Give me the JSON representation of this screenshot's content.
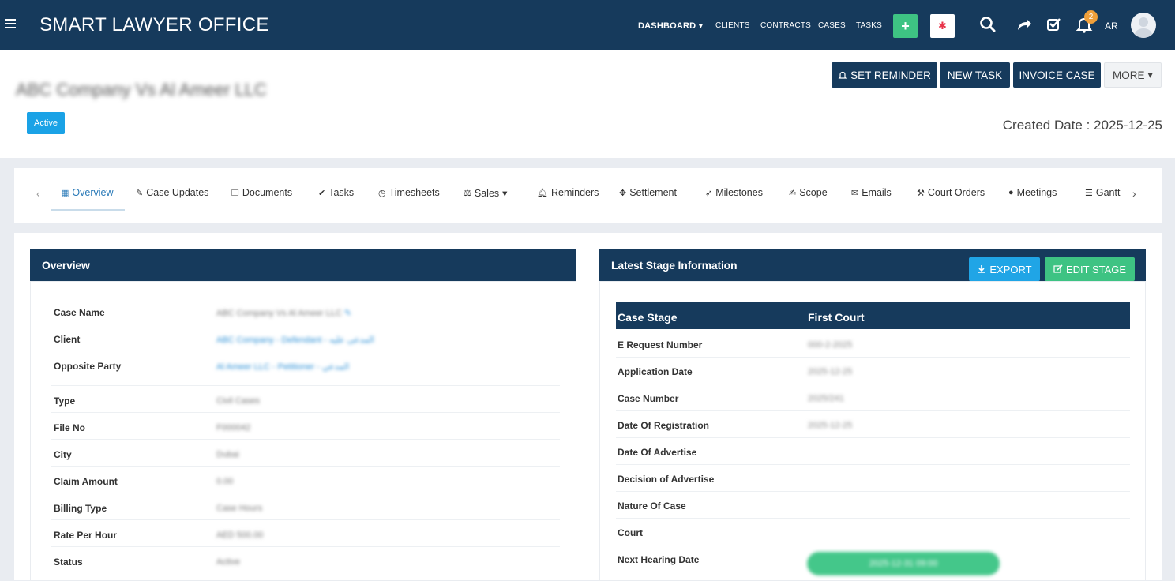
{
  "app": {
    "title": "SMART LAWYER OFFICE",
    "nav": [
      "DASHBOARD",
      "CLIENTS",
      "CONTRACTS",
      "CASES",
      "TASKS"
    ],
    "notification_count": "2",
    "language": "AR"
  },
  "case": {
    "title": "ABC Company Vs Al Ameer LLC",
    "status": "Active",
    "created_date": "Created Date : 2025-12-25",
    "actions": {
      "reminder": "SET REMINDER",
      "new_task": "NEW TASK",
      "invoice": "INVOICE CASE",
      "more": "MORE"
    }
  },
  "tabs": [
    {
      "label": "Overview",
      "icon": "grid-icon"
    },
    {
      "label": "Case Updates",
      "icon": "pencil-icon"
    },
    {
      "label": "Documents",
      "icon": "documents-icon"
    },
    {
      "label": "Tasks",
      "icon": "check-circle-icon"
    },
    {
      "label": "Timesheets",
      "icon": "clock-icon"
    },
    {
      "label": "Sales",
      "icon": "scale-icon"
    },
    {
      "label": "Reminders",
      "icon": "bell-icon"
    },
    {
      "label": "Settlement",
      "icon": "handshake-icon"
    },
    {
      "label": "Milestones",
      "icon": "rocket-icon"
    },
    {
      "label": "Scope",
      "icon": "edit-icon"
    },
    {
      "label": "Emails",
      "icon": "envelope-icon"
    },
    {
      "label": "Court Orders",
      "icon": "gavel-icon"
    },
    {
      "label": "Meetings",
      "icon": "comment-icon"
    },
    {
      "label": "Gantt",
      "icon": "bars-icon"
    }
  ],
  "overview": {
    "heading": "Overview",
    "rows": [
      {
        "label": "Case Name",
        "value": "ABC Company Vs Al Ameer LLC"
      },
      {
        "label": "Client",
        "value": "ABC Company - Defendant - المدعى عليه"
      },
      {
        "label": "Opposite Party",
        "value": "Al Ameer LLC - Petitioner - المدعي"
      },
      {
        "label": "Type",
        "value": "Civil Cases"
      },
      {
        "label": "File No",
        "value": "F000042"
      },
      {
        "label": "City",
        "value": "Dubai"
      },
      {
        "label": "Claim Amount",
        "value": "0.00"
      },
      {
        "label": "Billing Type",
        "value": "Case Hours"
      },
      {
        "label": "Rate Per Hour",
        "value": "AED 500.00"
      },
      {
        "label": "Status",
        "value": "Active"
      }
    ]
  },
  "stage": {
    "heading": "Latest Stage Information",
    "export_label": "EXPORT",
    "edit_label": "EDIT STAGE",
    "col_label": "Case Stage",
    "col_value": "First Court",
    "rows": [
      {
        "label": "E Request Number",
        "value": "000-2-2025"
      },
      {
        "label": "Application Date",
        "value": "2025-12-25"
      },
      {
        "label": "Case Number",
        "value": "2025/241"
      },
      {
        "label": "Date Of Registration",
        "value": "2025-12-25"
      },
      {
        "label": "Date Of Advertise",
        "value": ""
      },
      {
        "label": "Decision of Advertise",
        "value": ""
      },
      {
        "label": "Nature Of Case",
        "value": ""
      },
      {
        "label": "Court",
        "value": ""
      },
      {
        "label": "Next Hearing Date",
        "value": "2025-12-31 09:00"
      }
    ]
  }
}
